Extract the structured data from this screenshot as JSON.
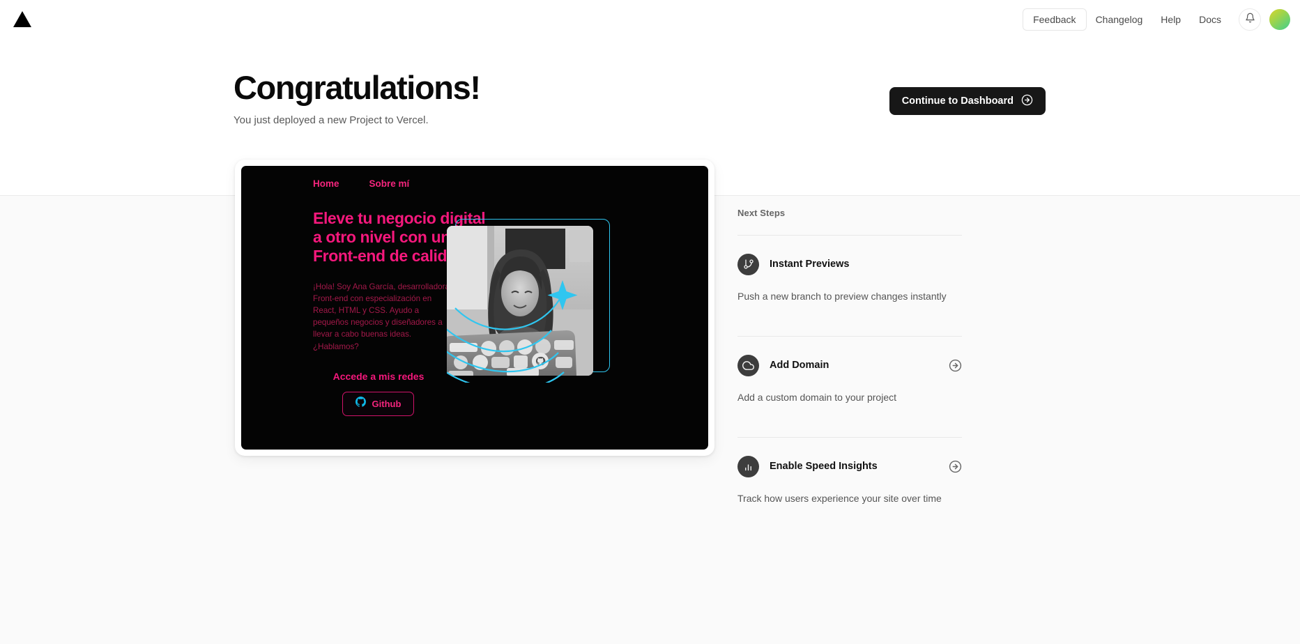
{
  "topnav": {
    "logo_icon": "vercel-triangle-icon",
    "feedback_label": "Feedback",
    "links": [
      {
        "label": "Changelog"
      },
      {
        "label": "Help"
      },
      {
        "label": "Docs"
      }
    ],
    "bell_icon": "notification-bell-icon",
    "avatar_icon": "user-avatar"
  },
  "hero": {
    "title": "Congratulations!",
    "subtitle": "You just deployed a new Project to Vercel.",
    "cta_label": "Continue to Dashboard",
    "cta_icon": "arrow-right-circle-icon"
  },
  "preview": {
    "nav": [
      {
        "label": "Home"
      },
      {
        "label": "Sobre mí"
      }
    ],
    "headline": "Eleve tu negocio digital a otro nivel con un Front-end de calidad!",
    "body": "¡Hola! Soy Ana García, desarrolladora Front-end con especialización en React, HTML y CSS. Ayudo a pequeños negocios y diseñadores a llevar a cabo buenas ideas. ¿Hablamos?",
    "social_heading": "Accede a mis redes",
    "github_label": "Github",
    "github_icon": "github-icon",
    "photo_alt": "developer-at-laptop-photo",
    "colors": {
      "accent_pink": "#f5187c",
      "body_pink": "#a4194a",
      "accent_cyan": "#2fc6f0",
      "background": "#040404"
    }
  },
  "next_steps": {
    "title": "Next Steps",
    "items": [
      {
        "label": "Instant Previews",
        "description": "Push a new branch to preview changes instantly",
        "icon": "git-branch-icon",
        "has_arrow": false
      },
      {
        "label": "Add Domain",
        "description": "Add a custom domain to your project",
        "icon": "cloud-icon",
        "has_arrow": true
      },
      {
        "label": "Enable Speed Insights",
        "description": "Track how users experience your site over time",
        "icon": "bar-chart-icon",
        "has_arrow": true
      }
    ]
  },
  "theme": {
    "page_background": "#ffffff",
    "lower_band_background": "#fafafa",
    "cta_background": "#171717",
    "text_primary": "#0a0a0a",
    "text_secondary": "#595959"
  }
}
